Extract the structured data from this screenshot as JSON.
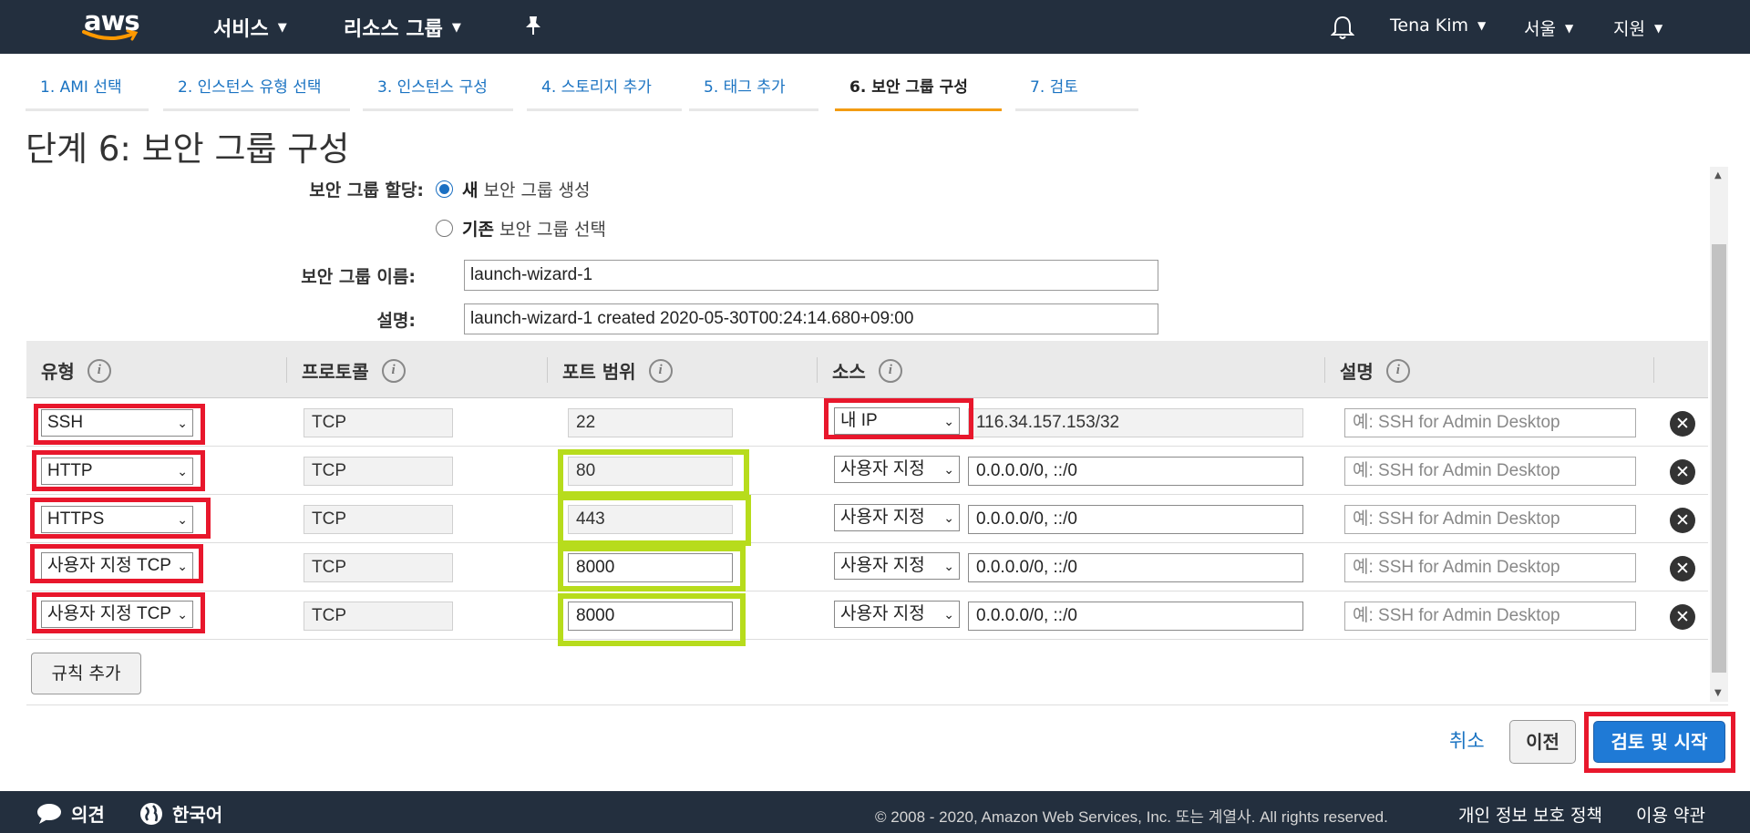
{
  "header": {
    "logo_text": "aws",
    "services": "서비스",
    "resource_groups": "리소스 그룹",
    "user": "Tena Kim",
    "region": "서울",
    "support": "지원"
  },
  "tabs": [
    {
      "label": "1. AMI 선택",
      "active": false
    },
    {
      "label": "2. 인스턴스 유형 선택",
      "active": false
    },
    {
      "label": "3. 인스턴스 구성",
      "active": false
    },
    {
      "label": "4. 스토리지 추가",
      "active": false
    },
    {
      "label": "5. 태그 추가",
      "active": false
    },
    {
      "label": "6. 보안 그룹 구성",
      "active": true
    },
    {
      "label": "7. 검토",
      "active": false
    }
  ],
  "page_title": "단계 6: 보안 그룹 구성",
  "form": {
    "assign_label": "보안 그룹 할당:",
    "radio_new_bold": "새",
    "radio_new_text": "보안 그룹 생성",
    "radio_existing_bold": "기존",
    "radio_existing_text": "보안 그룹 선택",
    "selected": "new",
    "name_label": "보안 그룹 이름:",
    "name_value": "launch-wizard-1",
    "desc_label": "설명:",
    "desc_value": "launch-wizard-1 created 2020-05-30T00:24:14.680+09:00"
  },
  "table": {
    "headers": {
      "type": "유형",
      "protocol": "프로토콜",
      "port": "포트 범위",
      "source": "소스",
      "description": "설명"
    },
    "description_placeholder": "예: SSH for Admin Desktop",
    "rows": [
      {
        "type": "SSH",
        "protocol": "TCP",
        "port": "22",
        "source": "내 IP",
        "cidr": "116.34.157.153/32"
      },
      {
        "type": "HTTP",
        "protocol": "TCP",
        "port": "80",
        "source": "사용자 지정",
        "cidr": "0.0.0.0/0, ::/0"
      },
      {
        "type": "HTTPS",
        "protocol": "TCP",
        "port": "443",
        "source": "사용자 지정",
        "cidr": "0.0.0.0/0, ::/0"
      },
      {
        "type": "사용자 지정 TCP",
        "protocol": "TCP",
        "port": "8000",
        "source": "사용자 지정",
        "cidr": "0.0.0.0/0, ::/0"
      },
      {
        "type": "사용자 지정 TCP",
        "protocol": "TCP",
        "port": "8000",
        "source": "사용자 지정",
        "cidr": "0.0.0.0/0, ::/0"
      }
    ]
  },
  "buttons": {
    "add_rule": "규칙 추가",
    "cancel": "취소",
    "previous": "이전",
    "review_launch": "검토 및 시작"
  },
  "footer": {
    "feedback": "의견",
    "language": "한국어",
    "copyright": "© 2008 - 2020, Amazon Web Services, Inc. 또는 계열사. All rights reserved.",
    "privacy": "개인 정보 보호 정책",
    "terms": "이용 약관"
  },
  "colors": {
    "nav_bg": "#232f3e",
    "link": "#1a73c2",
    "active_tab_underline": "#f39c12",
    "primary_button": "#1f7ad6",
    "highlight_red": "#e8172c",
    "highlight_green": "#b7dc1c"
  }
}
